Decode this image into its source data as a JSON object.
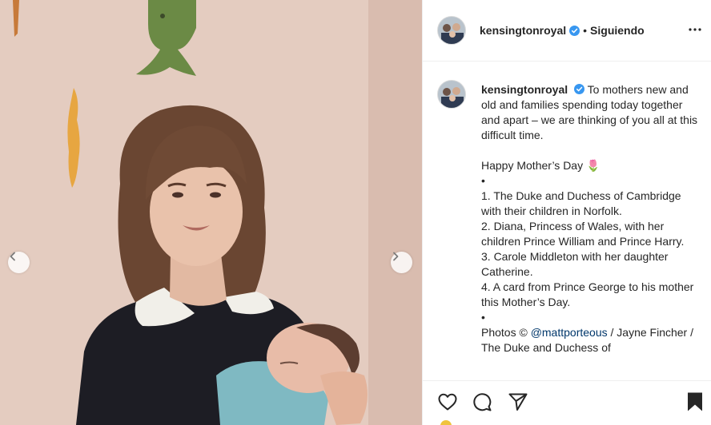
{
  "post": {
    "username": "kensingtonroyal",
    "separator": "•",
    "follow_status": "Siguiendo",
    "caption_lines": [
      "To mothers new and old and families spending today together and apart – we are thinking of you all at this difficult time.",
      "",
      "Happy Mother’s Day 🌷",
      "•",
      "1. The Duke and Duchess of Cambridge with their children in Norfolk.",
      "2. Diana, Princess of Wales, with her children Prince William and Prince Harry.",
      "3. Carole Middleton with her daughter Catherine.",
      "4. A card from Prince George to his mother this Mother’s Day.",
      "•"
    ],
    "credits_prefix": "Photos © ",
    "credits_mention": "@mattporteous",
    "credits_suffix": " / Jayne Fincher / The Duke and Duchess of"
  },
  "icons": {
    "verified": "verified-badge-icon",
    "more": "more-options-icon",
    "prev": "chevron-left-icon",
    "next": "chevron-right-icon",
    "like": "heart-icon",
    "comment": "comment-bubble-icon",
    "share": "paper-plane-icon",
    "save": "bookmark-icon"
  },
  "colors": {
    "verified_blue": "#3897f0",
    "text": "#262626",
    "mention": "#00376b",
    "border": "#efefef"
  }
}
